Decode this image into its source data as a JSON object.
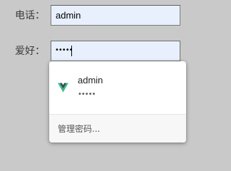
{
  "form": {
    "phone": {
      "label": "电话：",
      "value": "admin"
    },
    "hobby": {
      "label": "爱好：",
      "masked_value": "•••••"
    }
  },
  "autofill": {
    "suggestion": {
      "icon": "vue-logo-icon",
      "username": "admin",
      "masked_password": "•••••"
    },
    "manage_label": "管理密码..."
  },
  "colors": {
    "background": "#c9c9c9",
    "input_autofill_bg": "#e8f0fe",
    "vue_green": "#42b883",
    "vue_dark": "#35495e"
  }
}
